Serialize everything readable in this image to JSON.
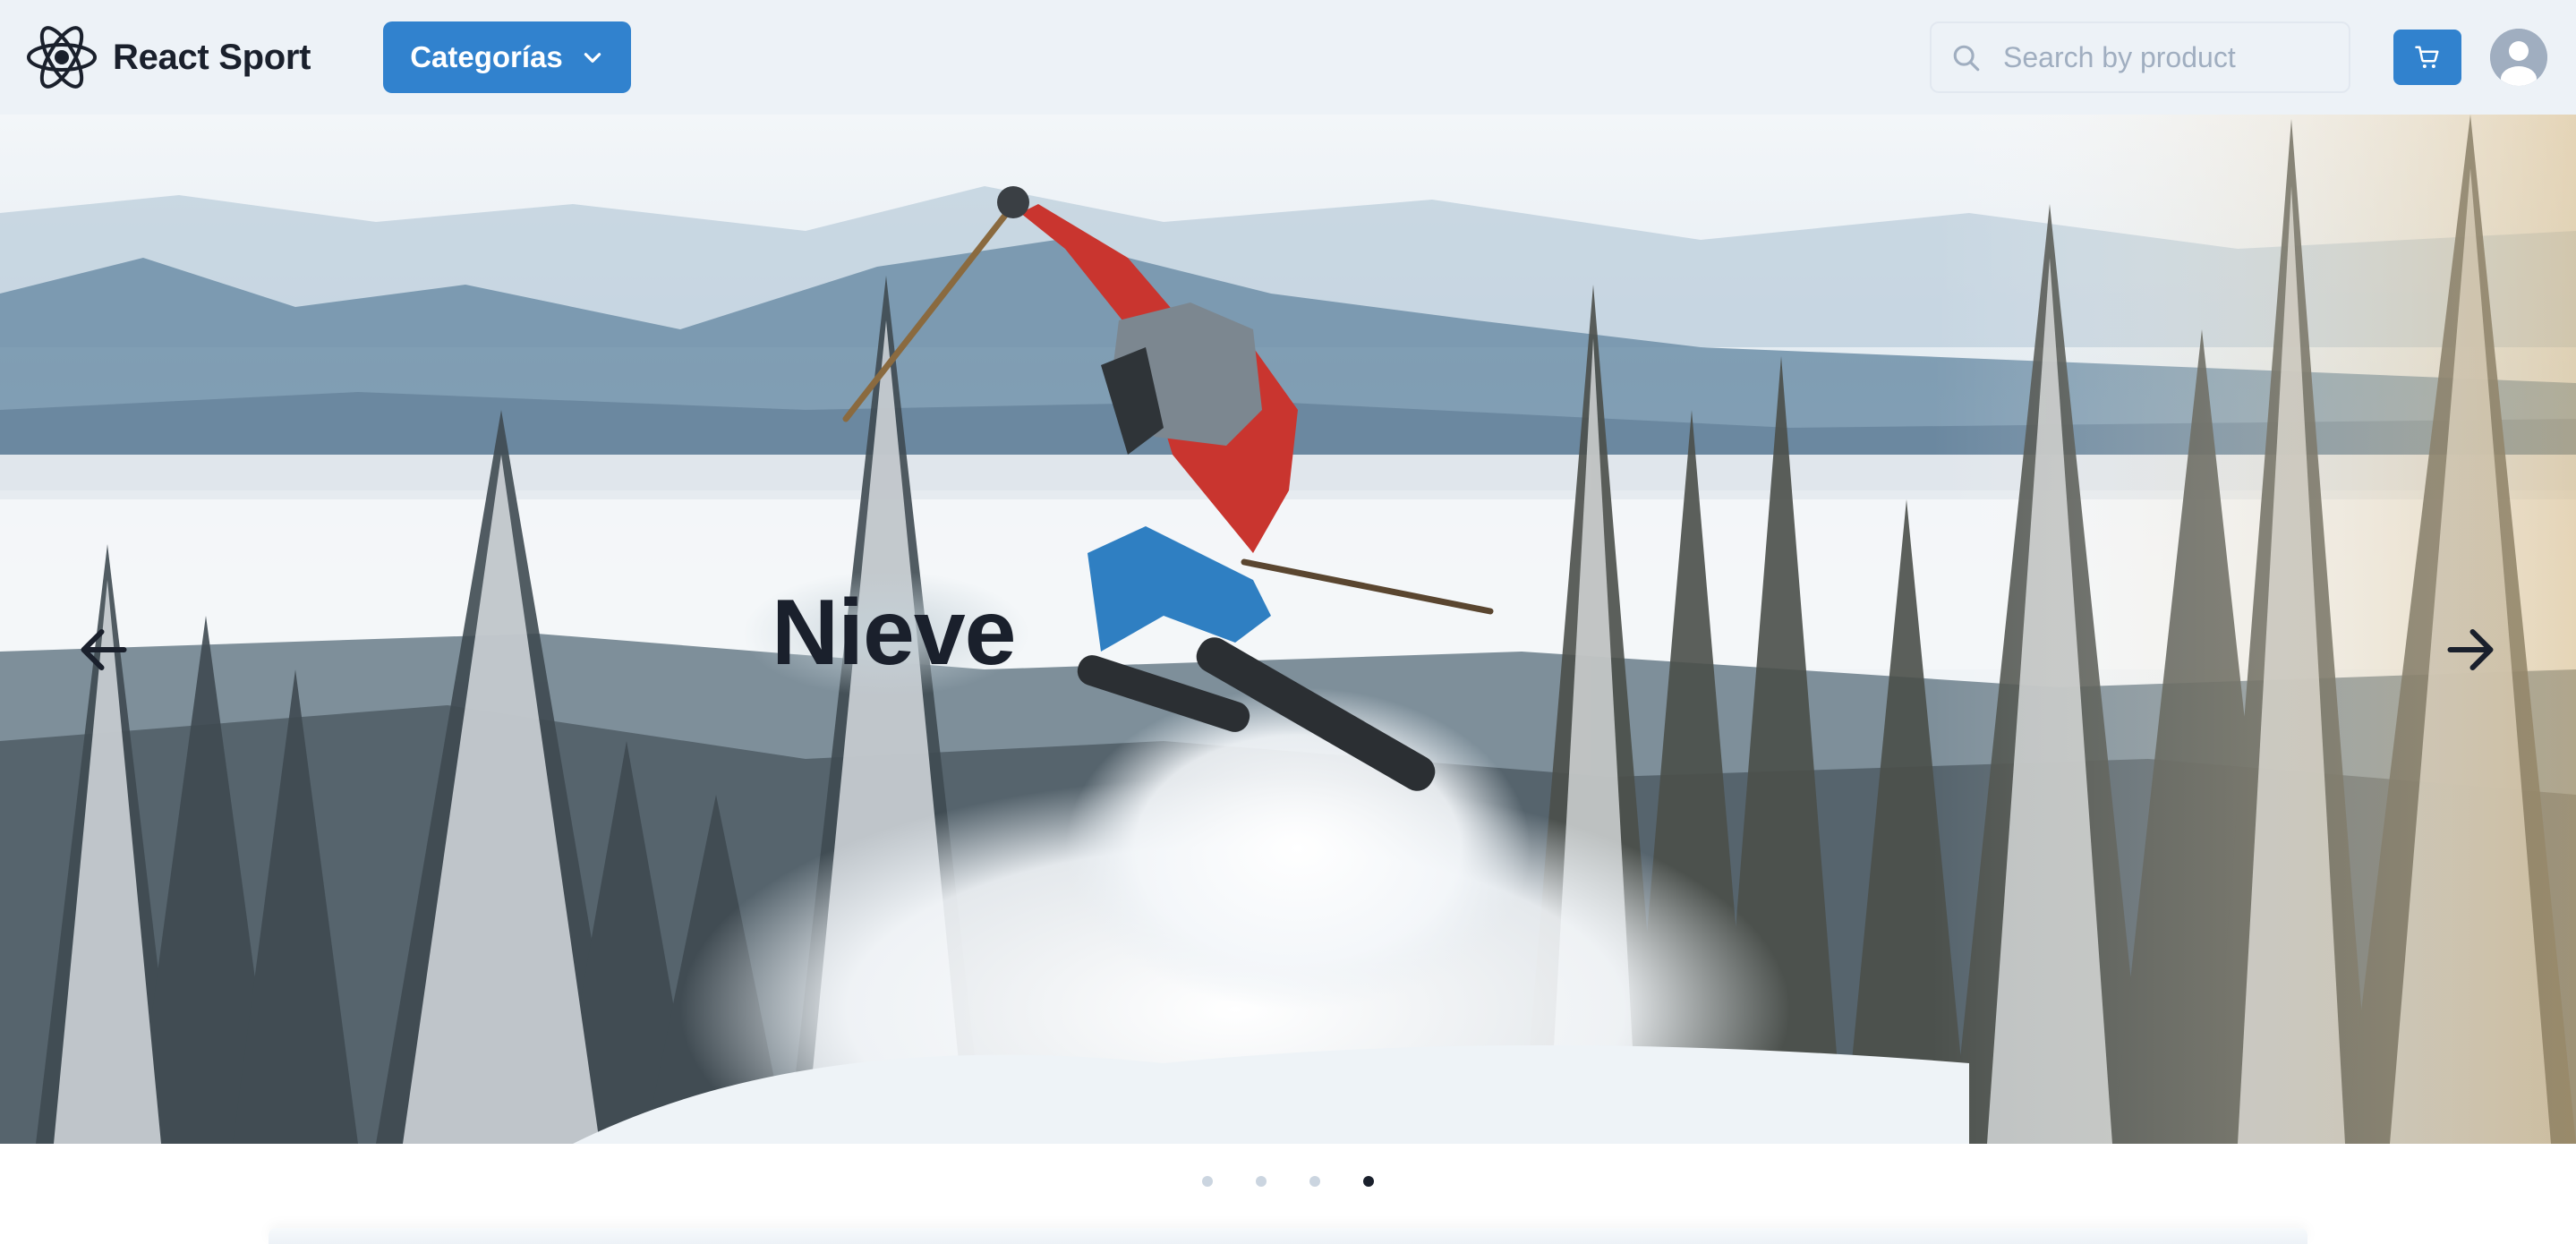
{
  "brand": {
    "name": "React Sport",
    "logo_icon": "react-atom-icon"
  },
  "nav": {
    "categories_label": "Categorías",
    "categories_icon": "chevron-down-icon"
  },
  "search": {
    "placeholder": "Search by product",
    "value": ""
  },
  "header_actions": {
    "cart_icon": "cart-icon",
    "avatar_icon": "user-avatar-icon"
  },
  "carousel": {
    "slide_title": "Nieve",
    "prev_icon": "arrow-left-icon",
    "next_icon": "arrow-right-icon",
    "slide_count": 4,
    "active_index": 3
  },
  "colors": {
    "primary": "#3182ce",
    "navbar_bg": "#edf2f7",
    "text_dark": "#1a202c",
    "placeholder": "#a0aec0"
  }
}
